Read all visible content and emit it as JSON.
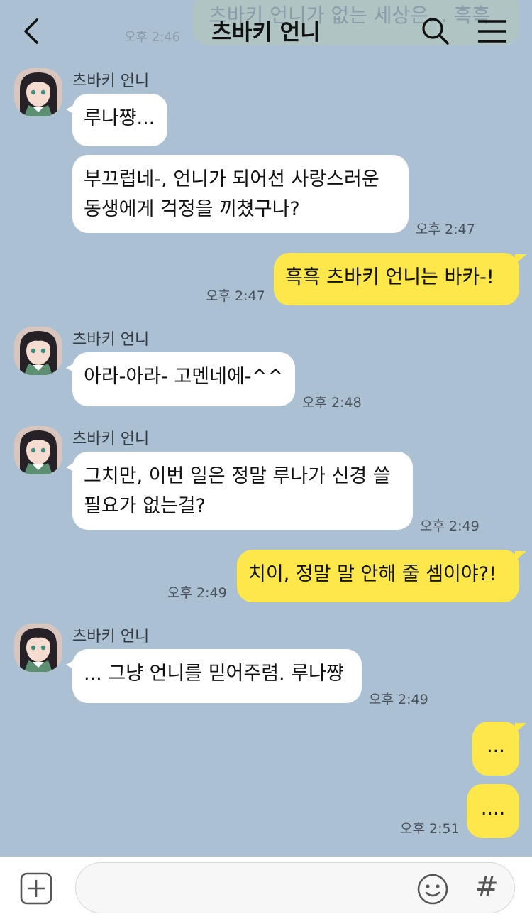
{
  "header": {
    "title": "츠바키 언니",
    "ghost_banner_text": "츠바키 언니가 없는 세상은... 흑흑",
    "ghost_banner_time": "오후 2:46"
  },
  "messages": [
    {
      "sender": "츠바키 언니",
      "text": "루나쨩...",
      "time": ""
    },
    {
      "text_line1": "부끄럽네-, 언니가 되어선 사랑스러운",
      "text_line2": "동생에게 걱정을 끼쳤구나?",
      "time": "오후 2:47"
    },
    {
      "text": "흑흑 츠바키 언니는 바카-!",
      "time": "오후 2:47"
    },
    {
      "sender": "츠바키 언니",
      "text": "아라-아라- 고멘네에-^^",
      "time": "오후 2:48"
    },
    {
      "sender": "츠바키 언니",
      "text_line1": "그치만, 이번 일은 정말 루나가 신경 쓸",
      "text_line2": "필요가 없는걸?",
      "time": "오후 2:49"
    },
    {
      "text": "치이, 정말 말 안해 줄 셈이야?!",
      "time": "오후 2:49"
    },
    {
      "sender": "츠바키 언니",
      "text": "... 그냥 언니를 믿어주렴. 루나쨩",
      "time": "오후 2:49"
    },
    {
      "text": "...",
      "time": ""
    },
    {
      "text": "....",
      "time": "오후 2:51"
    }
  ],
  "bottom_bar": {
    "input_value": "",
    "hash_label": "#"
  },
  "colors": {
    "background": "#abc0d2",
    "my_bubble": "#fde74b",
    "their_bubble": "#ffffff"
  }
}
